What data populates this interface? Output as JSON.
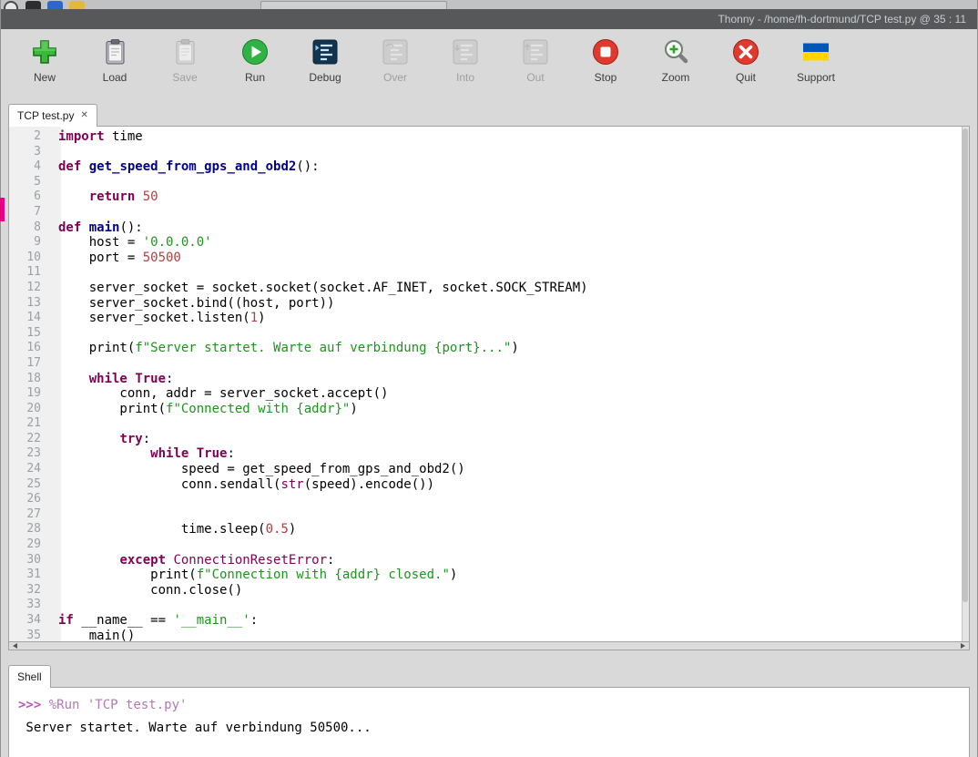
{
  "colors": {
    "run_green": "#2fb344",
    "stop_red": "#e03a2f",
    "new_green": "#3cb83c",
    "flag_blue": "#0057B7",
    "flag_yellow": "#FFD500",
    "keyword": "#7f0055",
    "string": "#1e941e",
    "number": "#b04040",
    "definition": "#00008b"
  },
  "title_bar": {
    "text": "Thonny - /home/fh-dortmund/TCP test.py @ 35 : 11"
  },
  "toolbar": {
    "buttons": [
      {
        "label": "New",
        "icon": "new-file-icon",
        "enabled": true
      },
      {
        "label": "Load",
        "icon": "load-file-icon",
        "enabled": true
      },
      {
        "label": "Save",
        "icon": "save-file-icon",
        "enabled": false
      },
      {
        "label": "Run",
        "icon": "run-icon",
        "enabled": true
      },
      {
        "label": "Debug",
        "icon": "debug-icon",
        "enabled": true
      },
      {
        "label": "Over",
        "icon": "step-over-icon",
        "enabled": false
      },
      {
        "label": "Into",
        "icon": "step-into-icon",
        "enabled": false
      },
      {
        "label": "Out",
        "icon": "step-out-icon",
        "enabled": false
      },
      {
        "label": "Stop",
        "icon": "stop-icon",
        "enabled": true
      },
      {
        "label": "Zoom",
        "icon": "zoom-icon",
        "enabled": true
      },
      {
        "label": "Quit",
        "icon": "quit-icon",
        "enabled": true
      },
      {
        "label": "Support",
        "icon": "support-flag-icon",
        "enabled": true
      }
    ]
  },
  "editor": {
    "tab": {
      "label": "TCP test.py",
      "close_glyph": "✕"
    },
    "cursor_position": "35 : 11",
    "lines": [
      {
        "n": 2,
        "segs": [
          [
            "kw",
            "import"
          ],
          [
            "pl",
            " time"
          ]
        ]
      },
      {
        "n": 3,
        "segs": []
      },
      {
        "n": 4,
        "segs": [
          [
            "kw",
            "def"
          ],
          [
            "pl",
            " "
          ],
          [
            "def",
            "get_speed_from_gps_and_obd2"
          ],
          [
            "pl",
            "():"
          ]
        ]
      },
      {
        "n": 5,
        "segs": []
      },
      {
        "n": 6,
        "segs": [
          [
            "pl",
            "    "
          ],
          [
            "kw",
            "return"
          ],
          [
            "pl",
            " "
          ],
          [
            "num",
            "50"
          ]
        ]
      },
      {
        "n": 7,
        "segs": []
      },
      {
        "n": 8,
        "segs": [
          [
            "kw",
            "def"
          ],
          [
            "pl",
            " "
          ],
          [
            "def",
            "main"
          ],
          [
            "pl",
            "():"
          ]
        ]
      },
      {
        "n": 9,
        "segs": [
          [
            "pl",
            "    host = "
          ],
          [
            "str",
            "'0.0.0.0'"
          ]
        ]
      },
      {
        "n": 10,
        "segs": [
          [
            "pl",
            "    port = "
          ],
          [
            "num",
            "50500"
          ]
        ]
      },
      {
        "n": 11,
        "segs": []
      },
      {
        "n": 12,
        "segs": [
          [
            "pl",
            "    server_socket = socket.socket(socket.AF_INET, socket.SOCK_STREAM)"
          ]
        ]
      },
      {
        "n": 13,
        "segs": [
          [
            "pl",
            "    server_socket.bind((host, port))"
          ]
        ]
      },
      {
        "n": 14,
        "segs": [
          [
            "pl",
            "    server_socket.listen("
          ],
          [
            "num",
            "1"
          ],
          [
            "pl",
            ")"
          ]
        ]
      },
      {
        "n": 15,
        "segs": []
      },
      {
        "n": 16,
        "segs": [
          [
            "pl",
            "    print("
          ],
          [
            "str",
            "f\"Server startet. Warte auf verbindung {port}...\""
          ],
          [
            "pl",
            ")"
          ]
        ]
      },
      {
        "n": 17,
        "segs": []
      },
      {
        "n": 18,
        "segs": [
          [
            "pl",
            "    "
          ],
          [
            "kw",
            "while"
          ],
          [
            "pl",
            " "
          ],
          [
            "kw",
            "True"
          ],
          [
            "pl",
            ":"
          ]
        ]
      },
      {
        "n": 19,
        "segs": [
          [
            "pl",
            "        conn, addr = server_socket.accept()"
          ]
        ]
      },
      {
        "n": 20,
        "segs": [
          [
            "pl",
            "        print("
          ],
          [
            "str",
            "f\"Connected with {addr}\""
          ],
          [
            "pl",
            ")"
          ]
        ]
      },
      {
        "n": 21,
        "segs": []
      },
      {
        "n": 22,
        "segs": [
          [
            "pl",
            "        "
          ],
          [
            "kw",
            "try"
          ],
          [
            "pl",
            ":"
          ]
        ]
      },
      {
        "n": 23,
        "segs": [
          [
            "pl",
            "            "
          ],
          [
            "kw",
            "while"
          ],
          [
            "pl",
            " "
          ],
          [
            "kw",
            "True"
          ],
          [
            "pl",
            ":"
          ]
        ]
      },
      {
        "n": 24,
        "segs": [
          [
            "pl",
            "                speed = get_speed_from_gps_and_obd2()"
          ]
        ]
      },
      {
        "n": 25,
        "segs": [
          [
            "pl",
            "                conn.sendall("
          ],
          [
            "bi",
            "str"
          ],
          [
            "pl",
            "(speed).encode())"
          ]
        ]
      },
      {
        "n": 26,
        "segs": []
      },
      {
        "n": 27,
        "segs": []
      },
      {
        "n": 28,
        "segs": [
          [
            "pl",
            "                time.sleep("
          ],
          [
            "num",
            "0.5"
          ],
          [
            "pl",
            ")"
          ]
        ]
      },
      {
        "n": 29,
        "segs": []
      },
      {
        "n": 30,
        "segs": [
          [
            "pl",
            "        "
          ],
          [
            "kw",
            "except"
          ],
          [
            "pl",
            " "
          ],
          [
            "bi",
            "ConnectionResetError"
          ],
          [
            "pl",
            ":"
          ]
        ]
      },
      {
        "n": 31,
        "segs": [
          [
            "pl",
            "            print("
          ],
          [
            "str",
            "f\"Connection with {addr} closed.\""
          ],
          [
            "pl",
            ")"
          ]
        ]
      },
      {
        "n": 32,
        "segs": [
          [
            "pl",
            "            conn.close()"
          ]
        ]
      },
      {
        "n": 33,
        "segs": []
      },
      {
        "n": 34,
        "segs": [
          [
            "kw",
            "if"
          ],
          [
            "pl",
            " __name__ == "
          ],
          [
            "str",
            "'__main__'"
          ],
          [
            "pl",
            ":"
          ]
        ]
      },
      {
        "n": 35,
        "segs": [
          [
            "pl",
            "    main()"
          ]
        ]
      }
    ]
  },
  "shell": {
    "tab": "Shell",
    "lines": [
      {
        "segs": [
          [
            "prompt",
            ">>> "
          ],
          [
            "magic",
            "%Run 'TCP test.py'"
          ]
        ]
      },
      {
        "segs": [
          [
            "out",
            " Server startet. Warte auf verbindung 50500..."
          ]
        ]
      }
    ]
  }
}
